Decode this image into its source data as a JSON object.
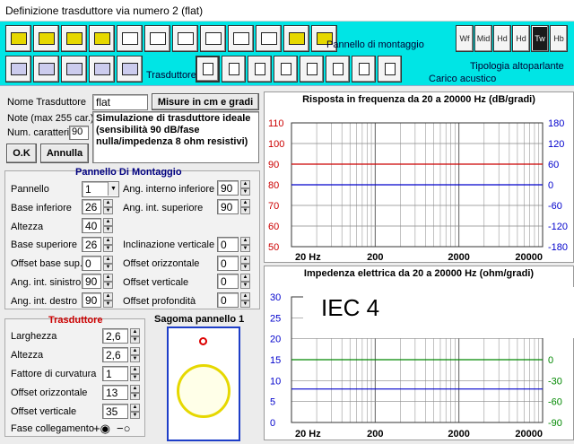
{
  "window": {
    "title": "Definizione trasduttore via numero 2 (flat)"
  },
  "toolbar": {
    "mount_label": "Pannello di montaggio",
    "trasduttore_label": "Trasduttore",
    "carico_label": "Carico acustico",
    "tipologia_label": "Tipologia altoparlante",
    "type_buttons": [
      "Wf",
      "Mid",
      "Hd",
      "Hd",
      "Tw",
      "Hb"
    ]
  },
  "form": {
    "name_label": "Nome Trasduttore",
    "name_value": "flat",
    "units_button": "Misure in cm e gradi",
    "note_label": "Note (max 255 car.)",
    "num_label": "Num. caratteri",
    "num_value": "90",
    "note_text": "Simulazione di trasduttore ideale (sensibilità 90 dB/fase nulla/impedenza 8 ohm resistivi)",
    "ok_button": "O.K",
    "cancel_button": "Annulla"
  },
  "panel": {
    "title": "Pannello Di Montaggio",
    "pannello_label": "Pannello",
    "pannello_value": "1",
    "base_inf_label": "Base inferiore",
    "base_inf_value": "26",
    "altezza_label": "Altezza",
    "altezza_value": "40",
    "base_sup_label": "Base superiore",
    "base_sup_value": "26",
    "off_base_label": "Offset base sup.",
    "off_base_value": "0",
    "ang_sin_label": "Ang. int. sinistro",
    "ang_sin_value": "90",
    "ang_des_label": "Ang. int. destro",
    "ang_des_value": "90",
    "ang_int_inf_label": "Ang. interno inferiore",
    "ang_int_inf_value": "90",
    "ang_int_sup_label": "Ang. int. superiore",
    "ang_int_sup_value": "90",
    "incl_label": "Inclinazione verticale",
    "incl_value": "0",
    "off_or_label": "Offset orizzontale",
    "off_or_value": "0",
    "off_ver_label": "Offset verticale",
    "off_ver_value": "0",
    "off_prof_label": "Offset profondità",
    "off_prof_value": "0"
  },
  "trasd": {
    "title": "Trasduttore",
    "larg_label": "Larghezza",
    "larg_value": "2,6",
    "alt_label": "Altezza",
    "alt_value": "2,6",
    "curv_label": "Fattore di curvatura",
    "curv_value": "1",
    "off_or_label": "Offset orizzontale",
    "off_or_value": "13",
    "off_ver_label": "Offset verticale",
    "off_ver_value": "35",
    "fase_label": "Fase collegamento"
  },
  "sagoma": {
    "title": "Sagoma pannello 1"
  },
  "overlay": {
    "text": "IEC 4"
  },
  "colors": {
    "toolbar": "#00e5e5",
    "left_axis": "#cc0000",
    "right_axis": "#0000cc",
    "green_axis": "#008800"
  },
  "chart_data": [
    {
      "type": "line",
      "title": "Risposta in frequenza da 20 a 20000 Hz (dB/gradi)",
      "x_ticks": [
        "20 Hz",
        "200",
        "2000",
        "20000"
      ],
      "y_left_ticks": [
        "110",
        "100",
        "90",
        "80",
        "70",
        "60",
        "50"
      ],
      "y_right_ticks": [
        "180",
        "120",
        "60",
        "0",
        "-60",
        "-120",
        "-180"
      ],
      "ylim_left": [
        50,
        110
      ],
      "ylim_right": [
        -180,
        180
      ],
      "series": [
        {
          "axis": "left",
          "color": "#cc0000",
          "y": 90
        },
        {
          "axis": "right",
          "color": "#0000cc",
          "y": 0
        }
      ]
    },
    {
      "type": "line",
      "title": "Impedenza elettrica da 20 a 20000 Hz (ohm/gradi)",
      "x_ticks": [
        "20 Hz",
        "200",
        "2000",
        "20000"
      ],
      "y_left_ticks": [
        "30",
        "25",
        "20",
        "15",
        "10",
        "5",
        "0"
      ],
      "y_right_ticks": [
        "0",
        "-30",
        "-60",
        "-90"
      ],
      "ylim_left": [
        0,
        30
      ],
      "series": [
        {
          "axis": "left",
          "color": "#0000cc",
          "y": 8
        },
        {
          "axis": "right",
          "color": "#008800",
          "y": 0
        }
      ]
    }
  ]
}
